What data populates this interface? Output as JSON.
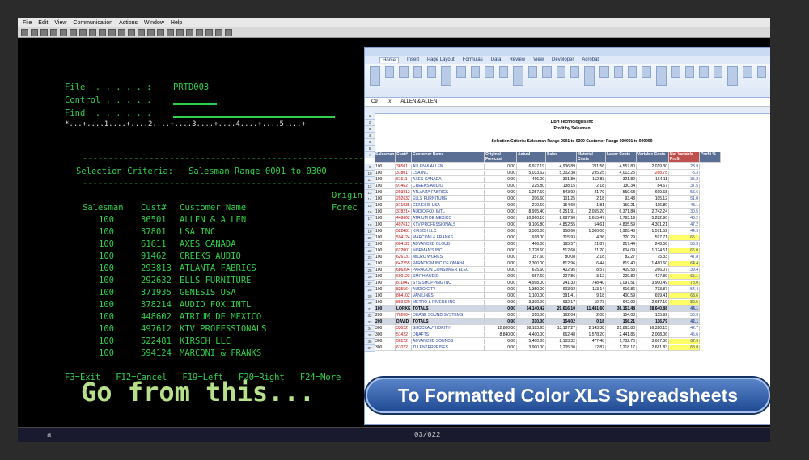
{
  "menu": [
    "File",
    "Edit",
    "View",
    "Communication",
    "Actions",
    "Window",
    "Help"
  ],
  "terminal": {
    "file_label": "File  . . . . . :",
    "file_value": "PRTD003",
    "control_label": "Control . . . . .",
    "find_label": "Find  . . . . . .",
    "ruler": "*...+....1....+....2....+....3....+....4....+....5....+",
    "dash_line": "----------------------------------------------------------------",
    "selection": "Selection Criteria:   Salesman Range 0001 to 0300",
    "origin": "Origin",
    "forecast": "Forec",
    "headers": {
      "salesman": "Salesman",
      "cust": "Cust#",
      "name": "Customer Name"
    },
    "rows": [
      {
        "s": "100",
        "c": "36501",
        "n": "ALLEN & ALLEN"
      },
      {
        "s": "100",
        "c": "37801",
        "n": "LSA INC"
      },
      {
        "s": "100",
        "c": "61611",
        "n": "AXES CANADA"
      },
      {
        "s": "100",
        "c": "91462",
        "n": "CREEKS AUDIO"
      },
      {
        "s": "100",
        "c": "293813",
        "n": "ATLANTA FABRICS"
      },
      {
        "s": "100",
        "c": "292632",
        "n": "ELLS FURNITURE"
      },
      {
        "s": "100",
        "c": "371935",
        "n": "GENESIS USA"
      },
      {
        "s": "100",
        "c": "378214",
        "n": "AUDIO FOX INTL"
      },
      {
        "s": "100",
        "c": "448602",
        "n": "ATRIUM DE MEXICO"
      },
      {
        "s": "100",
        "c": "497612",
        "n": "KTV PROFESSIONALS"
      },
      {
        "s": "100",
        "c": "522481",
        "n": "KIRSCH LLC"
      },
      {
        "s": "100",
        "c": "594124",
        "n": "MARCONI & FRANKS"
      }
    ],
    "fkeys": "F3=Exit   F12=Cancel   F19=Left   F20=Right   F24=More"
  },
  "go_text": "Go from this...",
  "status_page": "03/022",
  "status_left": "a",
  "excel": {
    "tabs": [
      "Home",
      "Insert",
      "Page Layout",
      "Formulas",
      "Data",
      "Review",
      "View",
      "Developer",
      "Acrobat"
    ],
    "cell_ref": "C9",
    "formula_value": "ALLEN & ALLEN",
    "title1": "DBH Technologies Inc",
    "title2": "Profit by Salesman",
    "criteria": "Selection Criteria:   Salesman Range 0001 to 0300       Customer Range 000001 to 999999",
    "headers": [
      "Salesman",
      "Cust#",
      "Customer Name",
      "Original Forecast",
      "Actual",
      "Sales",
      "Material Costs",
      "Labor Costs",
      "Variable Costs",
      "Net Variable Profit",
      "Profit %"
    ],
    "rows": [
      {
        "s": "100",
        "c": "36501",
        "n": "ALLEN & ALLEN",
        "v": [
          "0.00",
          "6,977.19",
          "4,936.89",
          "211.56",
          "4,557.80",
          "2,019.30",
          "28.9"
        ]
      },
      {
        "s": "100",
        "c": "37801",
        "n": "LSA INC",
        "v": [
          "0.00",
          "5,033.62",
          "5,302.38",
          "295.25",
          "4,013.25",
          "-268.78",
          "-5.3"
        ]
      },
      {
        "s": "100",
        "c": "61611",
        "n": "AXES CANADA",
        "v": [
          "0.00",
          "466.00",
          "301.89",
          "112.83",
          "321.82",
          "164.11",
          "35.2"
        ]
      },
      {
        "s": "100",
        "c": "91462",
        "n": "CREEKS AUDIO",
        "v": [
          "0.00",
          "225.80",
          "138.15",
          "2.18",
          "130.34",
          "84.67",
          "37.5"
        ]
      },
      {
        "s": "100",
        "c": "293813",
        "n": "ATLANTA FABRICS",
        "v": [
          "0.00",
          "1,257.60",
          "543.92",
          "21.79",
          "559.68",
          "699.68",
          "55.6"
        ]
      },
      {
        "s": "100",
        "c": "292632",
        "n": "ELLS FURNITURE",
        "v": [
          "0.00",
          "206.60",
          "101.25",
          "2.18",
          "93.48",
          "105.12",
          "51.0"
        ]
      },
      {
        "s": "100",
        "c": "371935",
        "n": "GENESIS USA",
        "v": [
          "0.00",
          "270.60",
          "154.60",
          "1.81",
          "150.21",
          "116.80",
          "43.1"
        ]
      },
      {
        "s": "100",
        "c": "378214",
        "n": "AUDIO FOX INTL",
        "v": [
          "0.00",
          "8,995.40",
          "6,251.91",
          "2,055.20",
          "6,371.84",
          "2,742.24",
          "30.5"
        ]
      },
      {
        "s": "100",
        "c": "448602",
        "n": "ATRIUM DE MEXICO",
        "v": [
          "0.00",
          "10,960.10",
          "2,687.90",
          "1,615.47",
          "1,793.19",
          "5,282.90",
          "48.2"
        ]
      },
      {
        "s": "100",
        "c": "497612",
        "n": "KTV PROFESSIONALS",
        "v": [
          "0.00",
          "9,106.80",
          "4,852.55",
          "54.61",
          "4,805.59",
          "4,301.21",
          "47.2"
        ]
      },
      {
        "s": "100",
        "c": "522481",
        "n": "KIRSCH LLC",
        "v": [
          "0.00",
          "3,500.00",
          "958.60",
          "1,300.00",
          "1,928.48",
          "1,571.52",
          "44.9"
        ]
      },
      {
        "s": "100",
        "c": "594124",
        "n": "MARCONI & FRANKS",
        "v": [
          "0.00",
          "918.00",
          "315.93",
          "4.36",
          "320.29",
          "597.71",
          "65.1"
        ]
      },
      {
        "s": "100",
        "c": "604122",
        "n": "ADVANCED CLOUD",
        "v": [
          "0.00",
          "466.00",
          "195.57",
          "21.87",
          "217.44",
          "248.56",
          "53.3"
        ]
      },
      {
        "s": "100",
        "c": "622001",
        "n": "NORMAN'S INC",
        "v": [
          "0.00",
          "1,728.60",
          "512.60",
          "21.20",
          "604.09",
          "1,124.51",
          "65.0"
        ]
      },
      {
        "s": "100",
        "c": "626131",
        "n": "MICRO WORKS",
        "v": [
          "0.00",
          "157.60",
          "80.08",
          "2.18",
          "82.27",
          "75.33",
          "47.8"
        ]
      },
      {
        "s": "100",
        "c": "642255",
        "n": "PARADIGM INC OF OMAHA",
        "v": [
          "0.00",
          "2,300.00",
          "812.96",
          "6.44",
          "819.40",
          "1,480.60",
          "64.4"
        ]
      },
      {
        "s": "100",
        "c": "686394",
        "n": "PARAGON CONSUMER ELEC",
        "v": [
          "0.00",
          "675.60",
          "402.95",
          "8.57",
          "409.53",
          "266.07",
          "39.4"
        ]
      },
      {
        "s": "100",
        "c": "690122",
        "n": "SMITH AUDIO",
        "v": [
          "0.00",
          "657.60",
          "227.86",
          "3.12",
          "229.80",
          "427.80",
          "65.1"
        ]
      },
      {
        "s": "100",
        "c": "811042",
        "n": "SYS SHOPPING INC",
        "v": [
          "0.00",
          "4,998.00",
          "241.33",
          "748.40",
          "1,097.51",
          "3,900.49",
          "78.0"
        ]
      },
      {
        "s": "100",
        "c": "825564",
        "n": "AUDIO CITY",
        "v": [
          "0.00",
          "1,350.00",
          "603.92",
          "113.14",
          "616.86",
          "733.87",
          "54.4"
        ]
      },
      {
        "s": "100",
        "c": "864102",
        "n": "VAN LINES",
        "v": [
          "0.00",
          "1,100.00",
          "391.41",
          "9.18",
          "400.59",
          "699.41",
          "63.6"
        ]
      },
      {
        "s": "100",
        "c": "889420",
        "n": "METRO & RIVERS INC",
        "v": [
          "0.00",
          "3,300.00",
          "632.17",
          "10.73",
          "642.90",
          "2,657.10",
          "80.5"
        ]
      }
    ],
    "total_row": {
      "s": "100",
      "c": "LORKE",
      "n": "TOTALS",
      "v": [
        "0.00",
        "64,140.42",
        "29,616.10",
        "11,481.60",
        "36,153.48",
        "28,640.88",
        "44.1"
      ]
    },
    "extra_rows": [
      {
        "s": "200",
        "c": "702004",
        "n": "OHASE SOUND SYSTEMS",
        "v": [
          "0.00",
          "310.00",
          "162.04",
          "2.00",
          "154.08",
          "155.92",
          "50.3"
        ]
      },
      {
        "s": "200",
        "c": "DAVID",
        "n": "TOTALS",
        "v": [
          "0.00",
          "310.00",
          "154.02",
          "0.18",
          "156.21",
          "116.79",
          "42.1"
        ]
      },
      {
        "s": "300",
        "c": "33022",
        "n": "SHOCKAUTHORITY",
        "v": [
          "12,800.00",
          "38,183.95",
          "13,187.27",
          "2,143.38",
          "21,863.80",
          "16,320.15",
          "42.7"
        ]
      },
      {
        "s": "300",
        "c": "51422",
        "n": "DRAFTS",
        "v": [
          "8,840.00",
          "4,400.00",
          "662.48",
          "1,578.20",
          "2,441.85",
          "2,008.06",
          "45.6"
        ]
      },
      {
        "s": "300",
        "c": "56122",
        "n": "ADVANCED SOUNDS",
        "v": [
          "0.00",
          "5,400.00",
          "2,103.32",
          "477.40",
          "1,732.70",
          "3,667.30",
          "67.9"
        ]
      },
      {
        "s": "300",
        "c": "61022",
        "n": "TLI ENTERPRISES",
        "v": [
          "0.00",
          "3,900.00",
          "1,205.30",
          "12.87",
          "1,218.17",
          "2,681.83",
          "68.8"
        ]
      }
    ],
    "sheet_tabs": "Sheet1   Sheet2   Sheet3"
  },
  "banner_text": "To Formatted Color XLS Spreadsheets"
}
